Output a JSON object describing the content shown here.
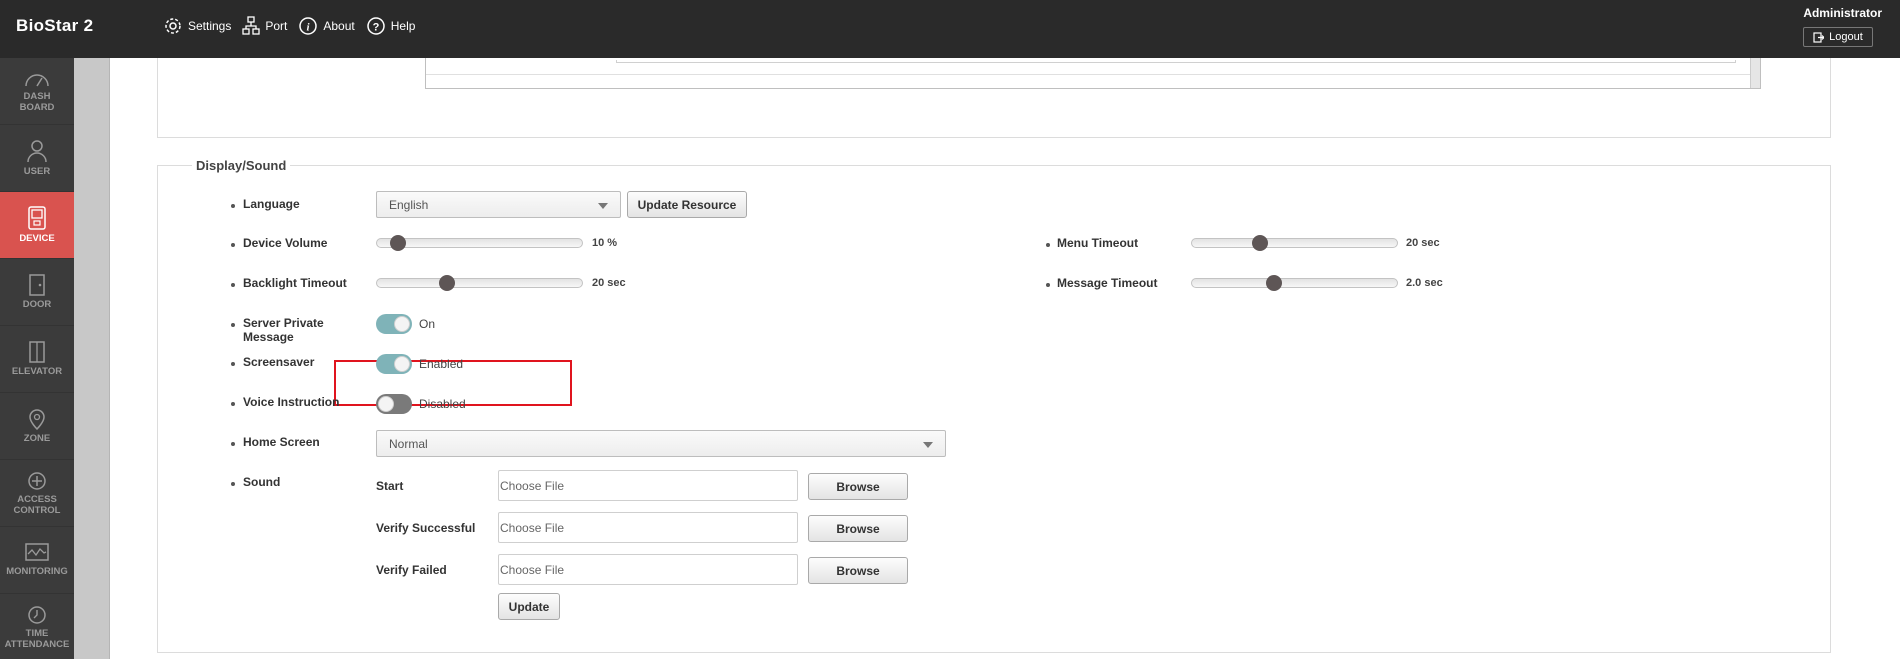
{
  "app": {
    "brand": "BioStar 2"
  },
  "topnav": {
    "settings": "Settings",
    "port": "Port",
    "about": "About",
    "help": "Help"
  },
  "user": {
    "name": "Administrator",
    "logout": "Logout"
  },
  "sidebar": {
    "items": [
      {
        "label1": "DASH",
        "label2": "BOARD"
      },
      {
        "label1": "USER",
        "label2": ""
      },
      {
        "label1": "DEVICE",
        "label2": ""
      },
      {
        "label1": "DOOR",
        "label2": ""
      },
      {
        "label1": "ELEVATOR",
        "label2": ""
      },
      {
        "label1": "ZONE",
        "label2": ""
      },
      {
        "label1": "ACCESS",
        "label2": "CONTROL"
      },
      {
        "label1": "MONITORING",
        "label2": ""
      },
      {
        "label1": "TIME",
        "label2": "ATTENDANCE"
      }
    ]
  },
  "display_sound": {
    "legend": "Display/Sound",
    "language": {
      "label": "Language",
      "value": "English",
      "update_button": "Update Resource"
    },
    "device_volume": {
      "label": "Device Volume",
      "value": "10 %",
      "level": 0.1
    },
    "backlight_timeout": {
      "label": "Backlight Timeout",
      "value": "20 sec",
      "level": 0.34
    },
    "menu_timeout": {
      "label": "Menu Timeout",
      "value": "20 sec",
      "level": 0.33
    },
    "message_timeout": {
      "label": "Message Timeout",
      "value": "2.0 sec",
      "level": 0.4
    },
    "server_private_message": {
      "label_line1": "Server Private",
      "label_line2": "Message",
      "state": "On"
    },
    "screensaver": {
      "label": "Screensaver",
      "state": "Enabled"
    },
    "voice_instruction": {
      "label": "Voice Instruction",
      "state": "Disabled"
    },
    "home_screen": {
      "label": "Home Screen",
      "value": "Normal"
    },
    "sound": {
      "label": "Sound",
      "start": {
        "label": "Start",
        "placeholder": "Choose File",
        "button": "Browse"
      },
      "verify_successful": {
        "label": "Verify Successful",
        "placeholder": "Choose File",
        "button": "Browse"
      },
      "verify_failed": {
        "label": "Verify Failed",
        "placeholder": "Choose File",
        "button": "Browse"
      },
      "update_button": "Update"
    }
  },
  "colors": {
    "topbar": "#2a2a2a",
    "sidebar": "#3b3b3b",
    "active_nav": "#d9534f",
    "toggle_on": "#7fb3b8",
    "highlight": "#e0141e"
  }
}
